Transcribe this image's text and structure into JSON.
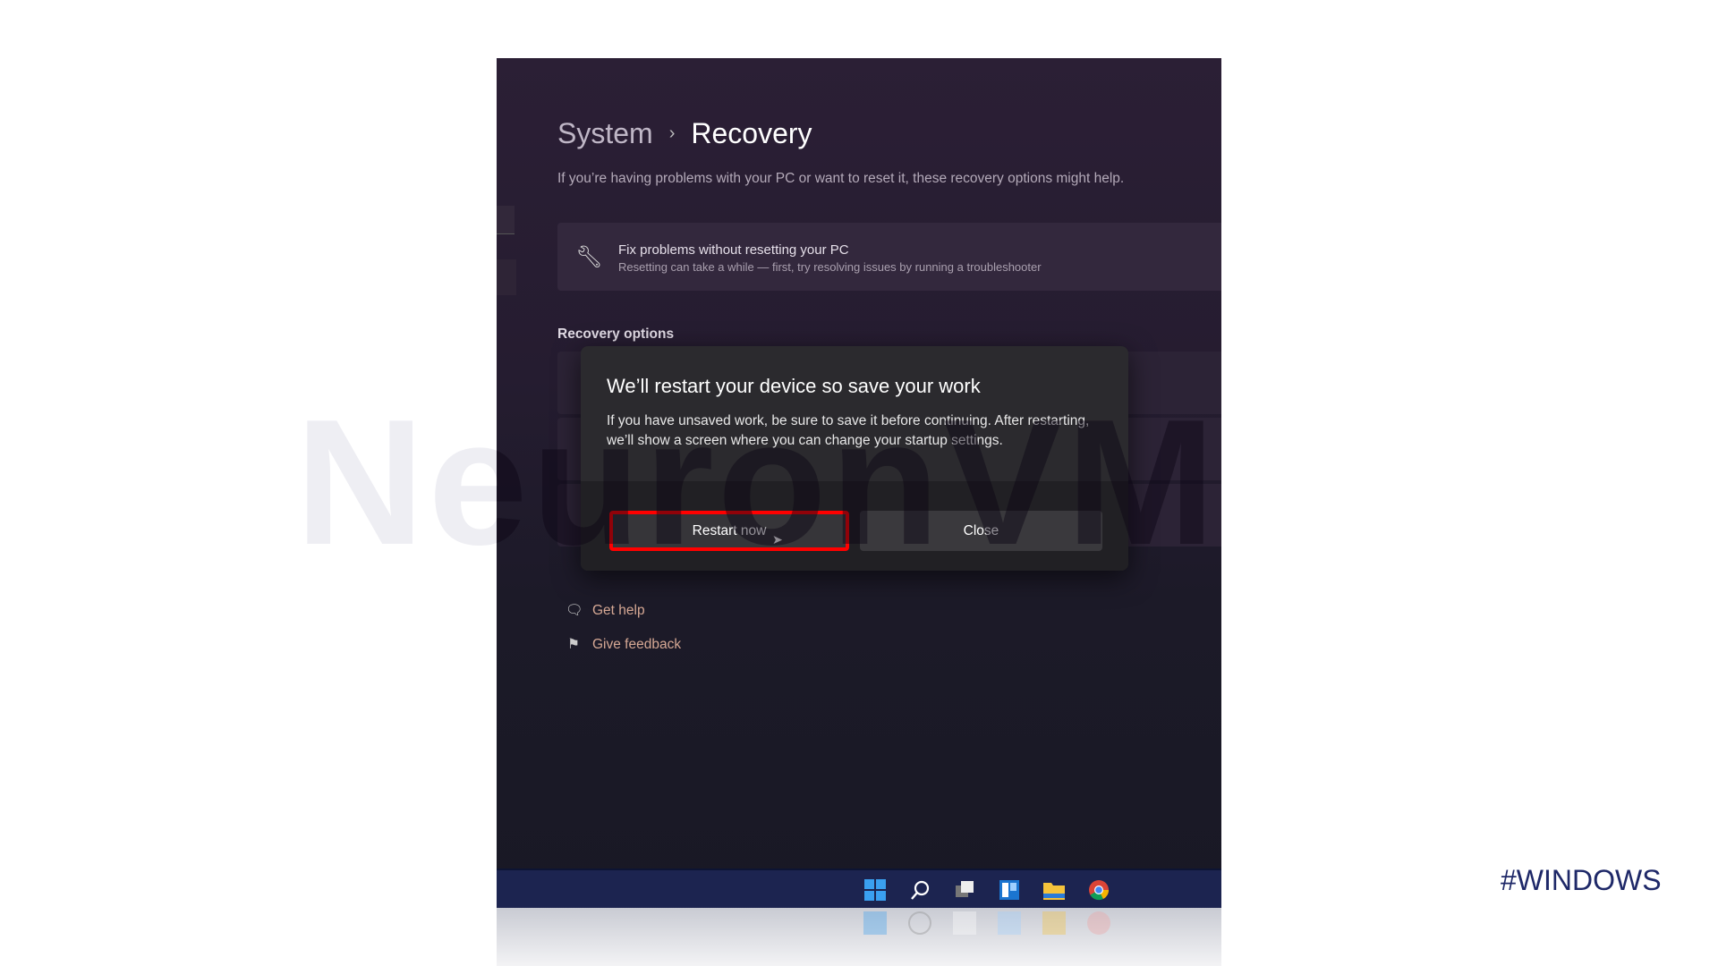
{
  "watermark": "NeuronVM",
  "breadcrumb": {
    "parent": "System",
    "separator": "›",
    "current": "Recovery"
  },
  "subtitle": "If you’re having problems with your PC or want to reset it, these recovery options might help.",
  "fix_card": {
    "icon": "wrench-icon",
    "title": "Fix problems without resetting your PC",
    "subtitle": "Resetting can take a while — first, try resolving issues by running a troubleshooter"
  },
  "section_title": "Recovery options",
  "dialog": {
    "title": "We’ll restart your device so save your work",
    "body": "If you have unsaved work, be sure to save it before continuing. After restarting, we’ll show a screen where you can change your startup settings.",
    "restart_label": "Restart now",
    "close_label": "Close",
    "highlight_color": "#ff0000"
  },
  "links": [
    {
      "icon": "get-help-icon",
      "label": "Get help"
    },
    {
      "icon": "feedback-icon",
      "label": "Give feedback"
    }
  ],
  "taskbar": [
    "start-icon",
    "search-icon",
    "task-view-icon",
    "widgets-icon",
    "file-explorer-icon",
    "chrome-icon"
  ],
  "hashtag": "#WINDOWS"
}
